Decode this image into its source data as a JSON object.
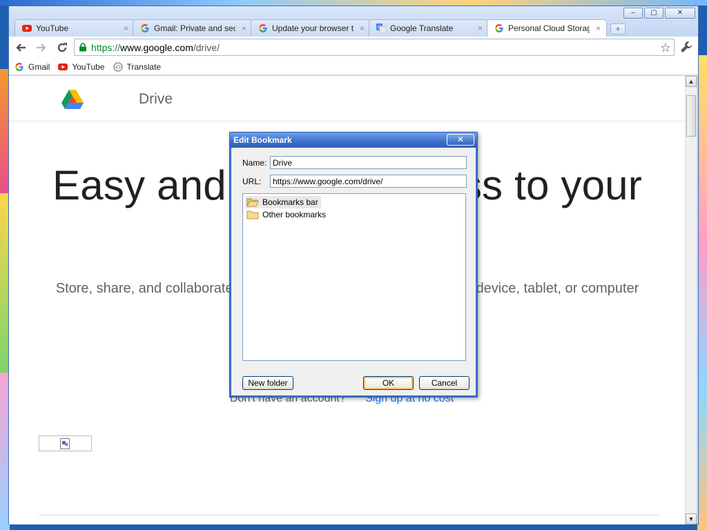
{
  "browser": {
    "tabs": [
      {
        "title": "YouTube",
        "favicon": "youtube-icon",
        "active": false
      },
      {
        "title": "Gmail: Private and secure",
        "favicon": "google-icon",
        "active": false
      },
      {
        "title": "Update your browser to use",
        "favicon": "google-icon",
        "active": false
      },
      {
        "title": "Google Translate",
        "favicon": "translate-icon",
        "active": false
      },
      {
        "title": "Personal Cloud Storage & File",
        "favicon": "google-icon",
        "active": true
      }
    ],
    "new_tab_symbol": "+",
    "window_buttons": {
      "minimize": "‒",
      "maximize": "▢",
      "close": "✕"
    },
    "url": {
      "scheme": "https://",
      "host": "www.google.com",
      "path": "/drive/"
    },
    "bookmarks": [
      {
        "label": "Gmail",
        "icon": "google-icon"
      },
      {
        "label": "YouTube",
        "icon": "youtube-icon"
      },
      {
        "label": "Translate",
        "icon": "globe-icon"
      }
    ]
  },
  "page": {
    "brand": "Drive",
    "hero_left": "Easy and",
    "hero_right": "ss to your",
    "subtitle_left": "Store, share, and collaborate",
    "subtitle_right": "device, tablet, or computer",
    "no_account": "Don't have an account?",
    "signup_link": "Sign up at no cost"
  },
  "dialog": {
    "title": "Edit Bookmark",
    "close_symbol": "✕",
    "name_label": "Name:",
    "name_value": "Drive",
    "url_label": "URL:",
    "url_value": "https://www.google.com/drive/",
    "folders": [
      {
        "label": "Bookmarks bar",
        "selected": true
      },
      {
        "label": "Other bookmarks",
        "selected": false
      }
    ],
    "new_folder_label": "New folder",
    "ok_label": "OK",
    "cancel_label": "Cancel"
  },
  "colors": {
    "url_scheme": "#0a8a2a",
    "link": "#1a73e8",
    "dialog_title": "#3b6fcd"
  }
}
